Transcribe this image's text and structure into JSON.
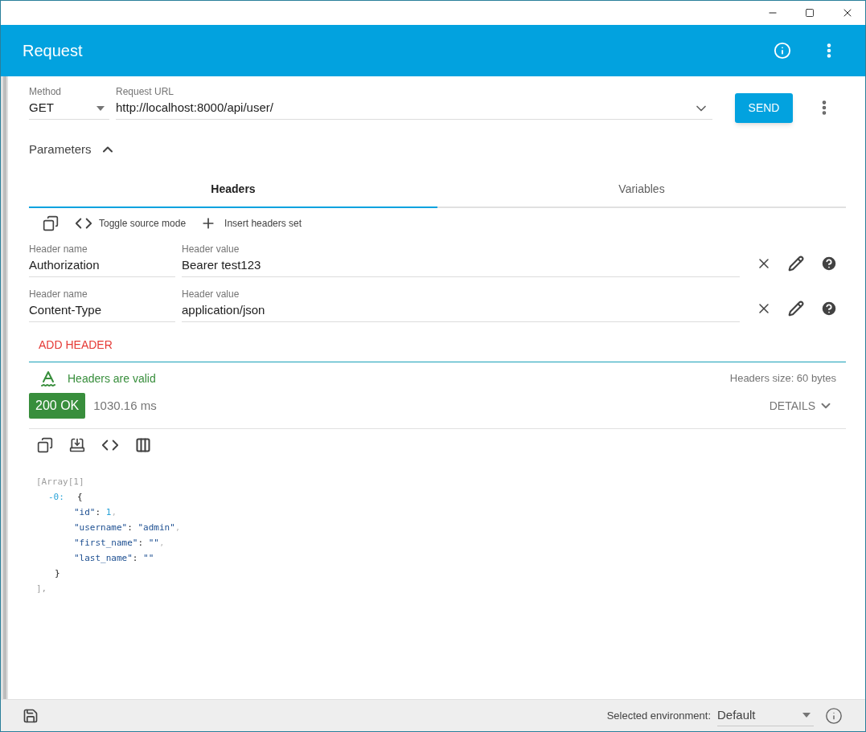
{
  "app_bar": {
    "title": "Request"
  },
  "request": {
    "method_label": "Method",
    "method": "GET",
    "url_label": "Request URL",
    "url": "http://localhost:8000/api/user/",
    "send": "SEND"
  },
  "parameters": {
    "title": "Parameters",
    "expanded": true
  },
  "tabs": [
    {
      "label": "Headers",
      "selected": true
    },
    {
      "label": "Variables",
      "selected": false
    }
  ],
  "toolbar": {
    "toggle": "Toggle source mode",
    "insert": "Insert headers set"
  },
  "headers": [
    {
      "name_label": "Header name",
      "name": "Authorization",
      "value_label": "Header value",
      "value": "Bearer test123"
    },
    {
      "name_label": "Header name",
      "name": "Content-Type",
      "value_label": "Header value",
      "value": "application/json"
    }
  ],
  "add_header": "ADD HEADER",
  "validation": {
    "message": "Headers are valid",
    "size": "Headers size: 60 bytes"
  },
  "response": {
    "status": "200 OK",
    "time": "1030.16 ms",
    "details": "DETAILS",
    "body": {
      "label": "[Array[1]",
      "items": [
        {
          "index": "-0:",
          "open": "{",
          "properties": [
            {
              "key": "\"id\"",
              "sep": ":",
              "value": "1",
              "kind": "number",
              "comma": ","
            },
            {
              "key": "\"username\"",
              "sep": ":",
              "value": "\"admin\"",
              "kind": "string",
              "comma": ","
            },
            {
              "key": "\"first_name\"",
              "sep": ":",
              "value": "\"\"",
              "kind": "string",
              "comma": ","
            },
            {
              "key": "\"last_name\"",
              "sep": ":",
              "value": "\"\"",
              "kind": "string"
            }
          ],
          "close": "}"
        }
      ],
      "close": "],"
    }
  },
  "status_bar": {
    "env_label": "Selected environment:",
    "environment": "Default"
  }
}
